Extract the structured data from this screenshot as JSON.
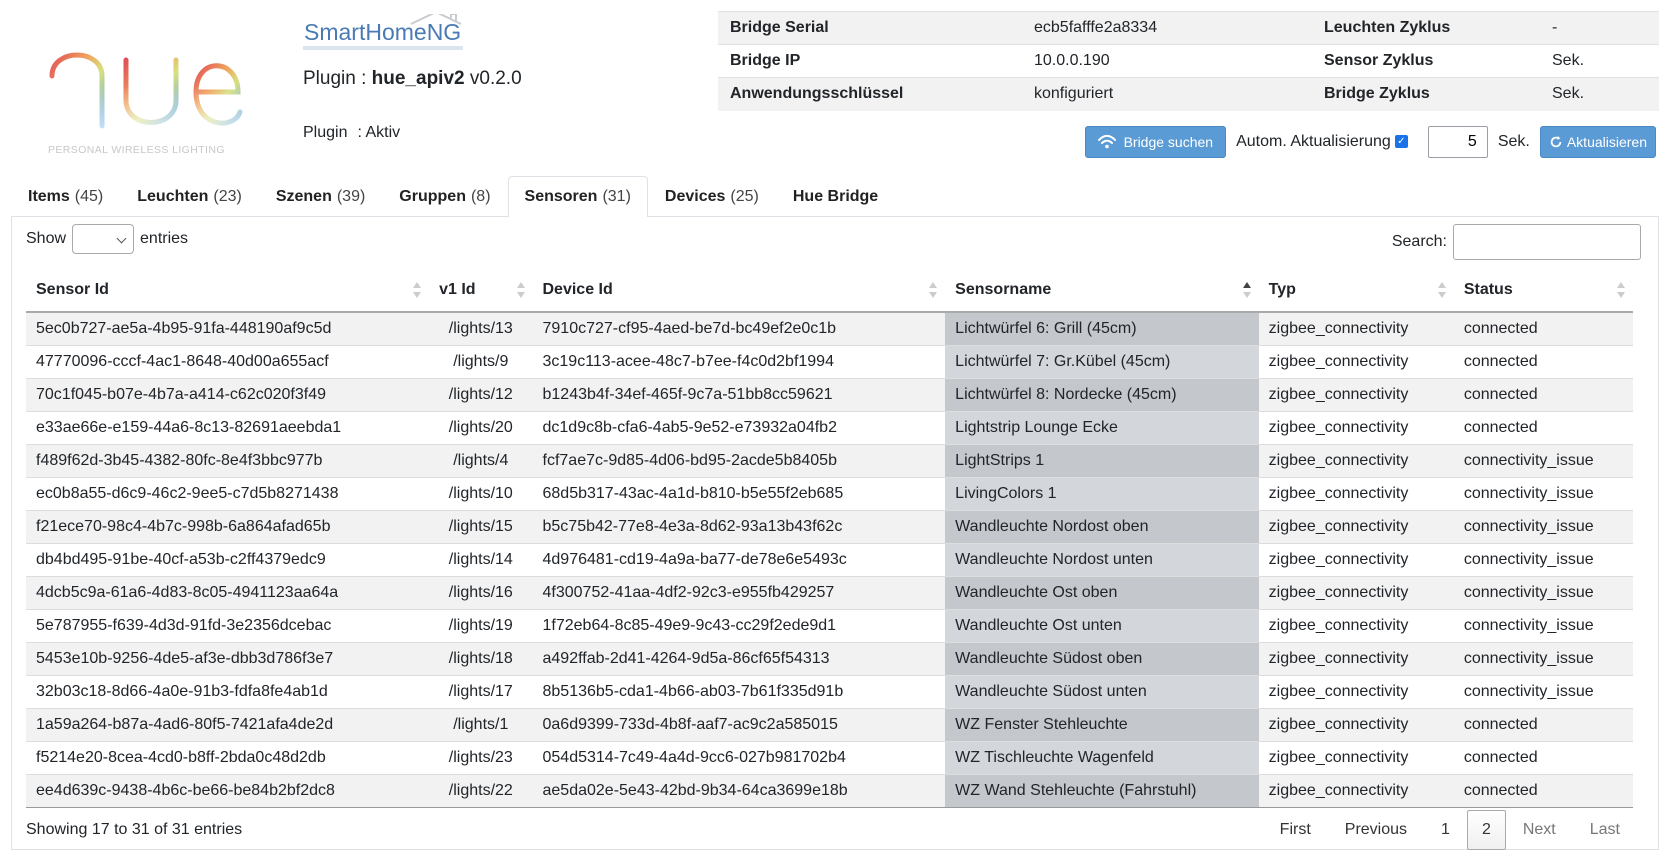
{
  "logo": {
    "wordmark": "hue",
    "tagline": "PERSONAL WIRELESS LIGHTING"
  },
  "brand": "SmartHomeNG",
  "plugin": {
    "prefix": "Plugin : ",
    "name": "hue_apiv2",
    "version": " v0.2.0",
    "status_label": "Plugin",
    "status_value": ": Aktiv"
  },
  "bridge_info": {
    "rows": [
      [
        "Bridge Serial",
        "ecb5fafffe2a8334",
        "Leuchten Zyklus",
        "-"
      ],
      [
        "Bridge IP",
        "10.0.0.190",
        "Sensor Zyklus",
        "Sek."
      ],
      [
        "Anwendungsschlüssel",
        "konfiguriert",
        "Bridge Zyklus",
        "Sek."
      ]
    ]
  },
  "controls": {
    "search_bridge": "Bridge suchen",
    "auto_update_label": "Autom. Aktualisierung",
    "auto_update_checked": true,
    "interval_value": "5",
    "interval_unit": "Sek.",
    "refresh": "Aktualisieren"
  },
  "tabs": [
    {
      "label": "Items",
      "count": "(45)",
      "active": false
    },
    {
      "label": "Leuchten",
      "count": "(23)",
      "active": false
    },
    {
      "label": "Szenen",
      "count": "(39)",
      "active": false
    },
    {
      "label": "Gruppen",
      "count": "(8)",
      "active": false
    },
    {
      "label": "Sensoren",
      "count": "(31)",
      "active": true
    },
    {
      "label": "Devices",
      "count": "(25)",
      "active": false
    },
    {
      "label": "Hue Bridge",
      "count": "",
      "active": false
    }
  ],
  "table_controls": {
    "show_label": "Show",
    "entries_label": "entries",
    "search_label": "Search:",
    "search_value": ""
  },
  "table": {
    "columns": [
      "Sensor Id",
      "v1 Id",
      "Device Id",
      "Sensorname",
      "Typ",
      "Status"
    ],
    "sorted_column": "Sensorname",
    "sort_direction": "ascending",
    "rows": [
      [
        "5ec0b727-ae5a-4b95-91fa-448190af9c5d",
        "/lights/13",
        "7910c727-cf95-4aed-be7d-bc49ef2e0c1b",
        "Lichtwürfel 6: Grill (45cm)",
        "zigbee_connectivity",
        "connected"
      ],
      [
        "47770096-cccf-4ac1-8648-40d00a655acf",
        "/lights/9",
        "3c19c113-acee-48c7-b7ee-f4c0d2bf1994",
        "Lichtwürfel 7: Gr.Kübel (45cm)",
        "zigbee_connectivity",
        "connected"
      ],
      [
        "70c1f045-b07e-4b7a-a414-c62c020f3f49",
        "/lights/12",
        "b1243b4f-34ef-465f-9c7a-51bb8cc59621",
        "Lichtwürfel 8: Nordecke (45cm)",
        "zigbee_connectivity",
        "connected"
      ],
      [
        "e33ae66e-e159-44a6-8c13-82691aeebda1",
        "/lights/20",
        "dc1d9c8b-cfa6-4ab5-9e52-e73932a04fb2",
        "Lightstrip Lounge Ecke",
        "zigbee_connectivity",
        "connected"
      ],
      [
        "f489f62d-3b45-4382-80fc-8e4f3bbc977b",
        "/lights/4",
        "fcf7ae7c-9d85-4d06-bd95-2acde5b8405b",
        "LightStrips 1",
        "zigbee_connectivity",
        "connectivity_issue"
      ],
      [
        "ec0b8a55-d6c9-46c2-9ee5-c7d5b8271438",
        "/lights/10",
        "68d5b317-43ac-4a1d-b810-b5e55f2eb685",
        "LivingColors 1",
        "zigbee_connectivity",
        "connectivity_issue"
      ],
      [
        "f21ece70-98c4-4b7c-998b-6a864afad65b",
        "/lights/15",
        "b5c75b42-77e8-4e3a-8d62-93a13b43f62c",
        "Wandleuchte Nordost oben",
        "zigbee_connectivity",
        "connectivity_issue"
      ],
      [
        "db4bd495-91be-40cf-a53b-c2ff4379edc9",
        "/lights/14",
        "4d976481-cd19-4a9a-ba77-de78e6e5493c",
        "Wandleuchte Nordost unten",
        "zigbee_connectivity",
        "connectivity_issue"
      ],
      [
        "4dcb5c9a-61a6-4d83-8c05-4941123aa64a",
        "/lights/16",
        "4f300752-41aa-4df2-92c3-e955fb429257",
        "Wandleuchte Ost oben",
        "zigbee_connectivity",
        "connectivity_issue"
      ],
      [
        "5e787955-f639-4d3d-91fd-3e2356dcebac",
        "/lights/19",
        "1f72eb64-8c85-49e9-9c43-cc29f2ede9d1",
        "Wandleuchte Ost unten",
        "zigbee_connectivity",
        "connectivity_issue"
      ],
      [
        "5453e10b-9256-4de5-af3e-dbb3d786f3e7",
        "/lights/18",
        "a492ffab-2d41-4264-9d5a-86cf65f54313",
        "Wandleuchte Südost oben",
        "zigbee_connectivity",
        "connectivity_issue"
      ],
      [
        "32b03c18-8d66-4a0e-91b3-fdfa8fe4ab1d",
        "/lights/17",
        "8b5136b5-cda1-4b66-ab03-7b61f335d91b",
        "Wandleuchte Südost unten",
        "zigbee_connectivity",
        "connectivity_issue"
      ],
      [
        "1a59a264-b87a-4ad6-80f5-7421afa4de2d",
        "/lights/1",
        "0a6d9399-733d-4b8f-aaf7-ac9c2a585015",
        "WZ Fenster Stehleuchte",
        "zigbee_connectivity",
        "connected"
      ],
      [
        "f5214e20-8cea-4cd0-b8ff-2bda0c48d2db",
        "/lights/23",
        "054d5314-7c49-4a4d-9cc6-027b981702b4",
        "WZ Tischleuchte Wagenfeld",
        "zigbee_connectivity",
        "connected"
      ],
      [
        "ee4d639c-9438-4b6c-be66-be84b2bf2dc8",
        "/lights/22",
        "ae5da02e-5e43-42bd-9b34-64ca3699e18b",
        "WZ Wand Stehleuchte (Fahrstuhl)",
        "zigbee_connectivity",
        "connected"
      ]
    ]
  },
  "footer": {
    "info": "Showing 17 to 31 of 31 entries",
    "first": "First",
    "previous": "Previous",
    "pages": [
      "1",
      "2"
    ],
    "current_page": "2",
    "next": "Next",
    "last": "Last"
  },
  "colors": {
    "button": "#5b9bd5",
    "sorted_column_odd": "#c4c7cc",
    "sorted_column_even": "#d3d6db",
    "row_stripe": "#f2f2f2"
  }
}
